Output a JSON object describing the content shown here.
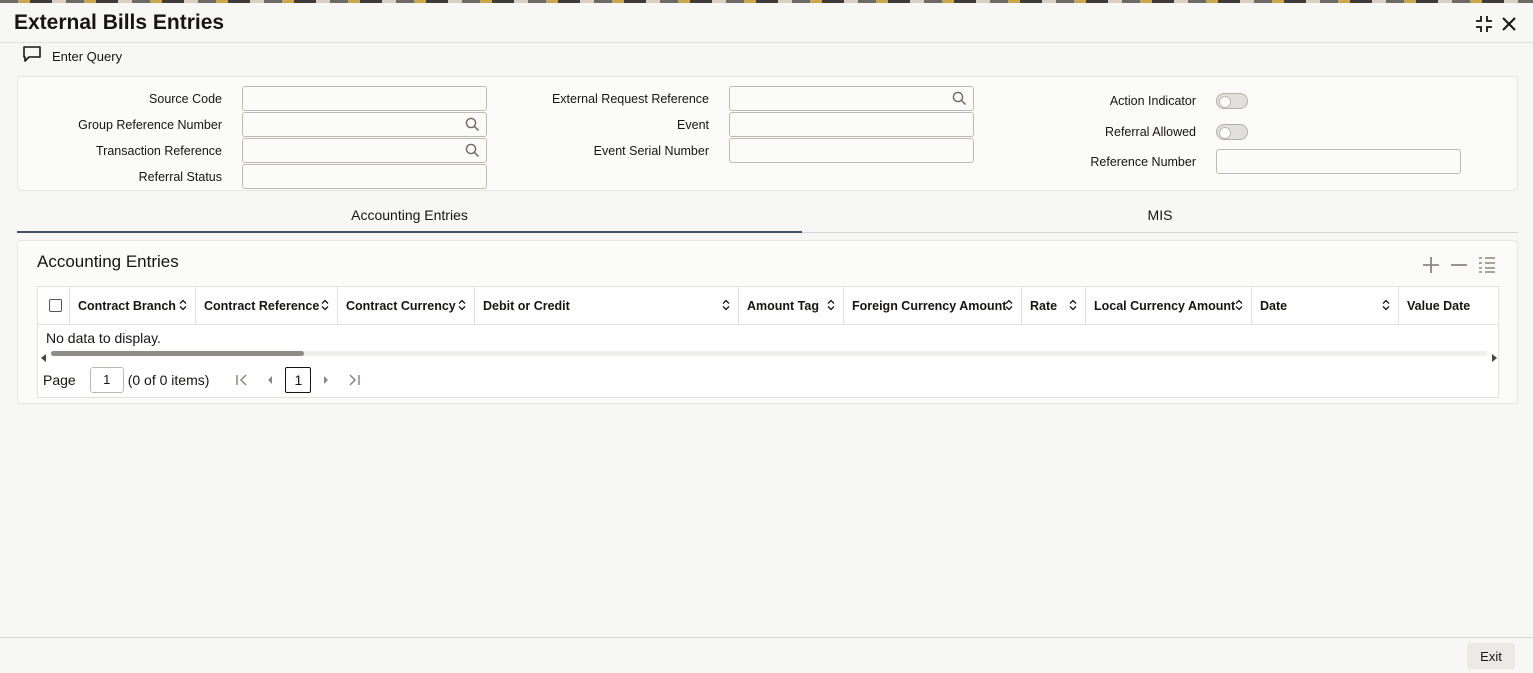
{
  "window": {
    "title": "External Bills Entries",
    "controls": [
      "restore-icon",
      "close-icon"
    ]
  },
  "toolbar": {
    "enter_query_label": "Enter Query",
    "enter_query_icon": "chat-icon"
  },
  "header": {
    "source_code": {
      "label": "Source Code",
      "value": ""
    },
    "group_reference_number": {
      "label": "Group Reference Number",
      "value": ""
    },
    "transaction_reference": {
      "label": "Transaction Reference",
      "value": ""
    },
    "referral_status": {
      "label": "Referral Status",
      "value": ""
    },
    "external_request_reference": {
      "label": "External Request Reference",
      "value": ""
    },
    "event": {
      "label": "Event",
      "value": ""
    },
    "event_serial_number": {
      "label": "Event Serial Number",
      "value": ""
    },
    "action_indicator": {
      "label": "Action Indicator",
      "checked": false
    },
    "referral_allowed": {
      "label": "Referral Allowed",
      "checked": false
    },
    "reference_number": {
      "label": "Reference Number",
      "value": ""
    }
  },
  "tabs": [
    {
      "label": "Accounting Entries",
      "active": true
    },
    {
      "label": "MIS",
      "active": false
    }
  ],
  "accounting_entries": {
    "title": "Accounting Entries",
    "actions": [
      "add-icon",
      "remove-icon",
      "list-icon"
    ],
    "columns": [
      "Contract Branch",
      "Contract Reference",
      "Contract Currency",
      "Debit or Credit",
      "Amount Tag",
      "Foreign Currency Amount",
      "Rate",
      "Local Currency Amount",
      "Date",
      "Value Date"
    ],
    "rows": [],
    "empty_text": "No data to display.",
    "pagination": {
      "page_label": "Page",
      "page_value": "1",
      "items_text": "(0 of 0 items)",
      "current_page": "1"
    }
  },
  "footer": {
    "exit_label": "Exit"
  },
  "colors": {
    "accent_tab": "#3f4d66",
    "background": "#f7f7f6",
    "text": "#161513"
  }
}
